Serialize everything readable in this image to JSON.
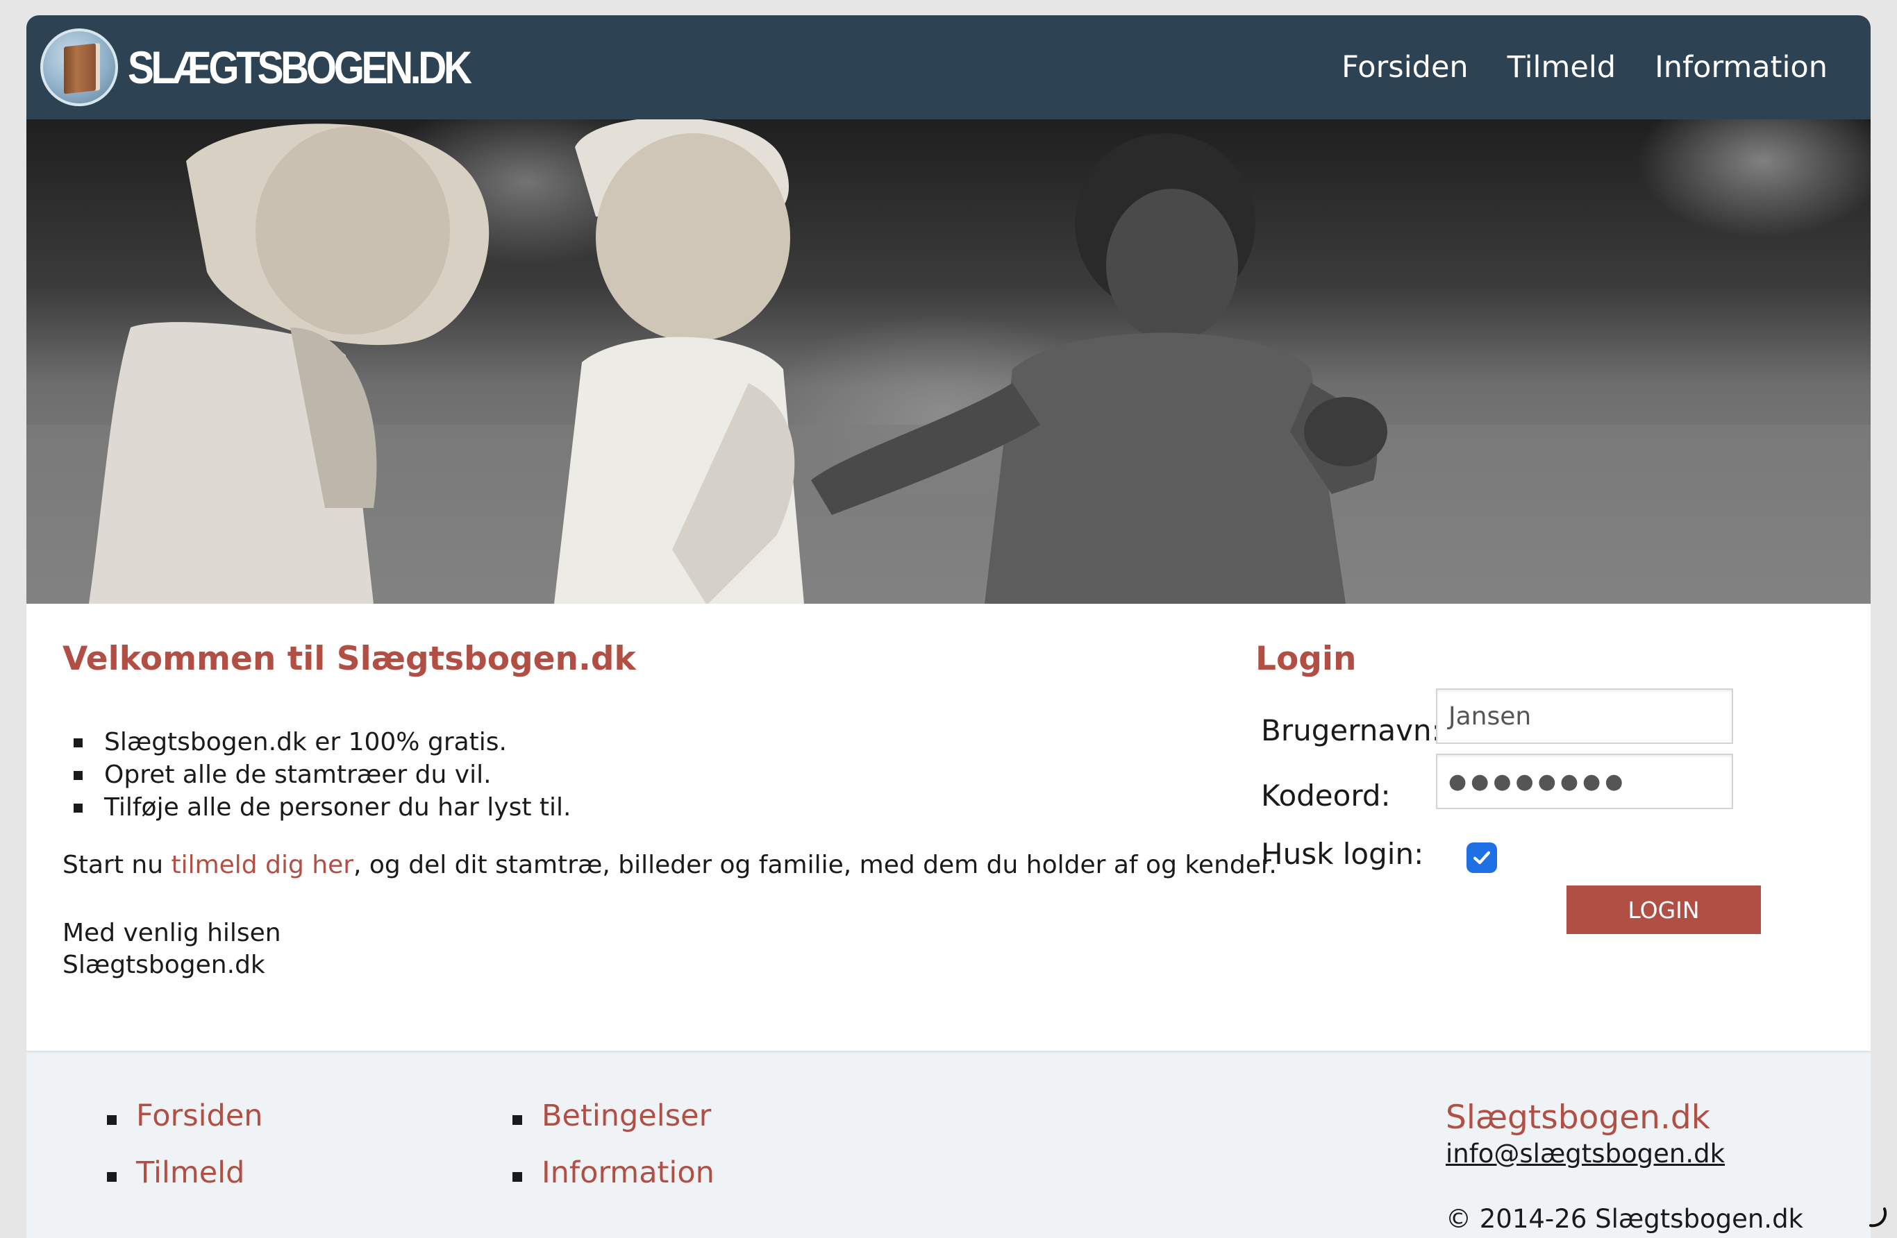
{
  "brand": {
    "logo_text": "SLÆGTSBOGEN.DK"
  },
  "nav": {
    "items": [
      {
        "label": "Forsiden"
      },
      {
        "label": "Tilmeld"
      },
      {
        "label": "Information"
      }
    ]
  },
  "welcome": {
    "title": "Velkommen til Slægtsbogen.dk",
    "features": [
      "Slægtsbogen.dk er 100% gratis.",
      "Opret alle de stamtræer du vil.",
      "Tilføje alle de personer du har lyst til."
    ],
    "intro_before": "Start nu ",
    "intro_link": "tilmeld dig her",
    "intro_after": ", og del dit stamtræ, billeder og familie, med dem du holder af og kender.",
    "signoff_line1": "Med venlig hilsen",
    "signoff_line2": "Slægtsbogen.dk"
  },
  "login": {
    "title": "Login",
    "username_label": "Brugernavn:",
    "username_value": "Jansen",
    "password_label": "Kodeord:",
    "password_value": "●●●●●●●●",
    "remember_label": "Husk login:",
    "remember_checked": true,
    "button_label": "LOGIN"
  },
  "footer": {
    "links_col1": [
      "Forsiden",
      "Tilmeld"
    ],
    "links_col2": [
      "Betingelser",
      "Information"
    ],
    "brand": "Slægtsbogen.dk",
    "email": "info@slægtsbogen.dk",
    "copyright": "© 2014-26 Slægtsbogen.dk"
  },
  "colors": {
    "header_bg": "#2d4252",
    "accent": "#b14f44",
    "footer_bg": "#f0f3f6",
    "checkbox": "#1f6fe5"
  },
  "icons": [
    "book-globe-logo-icon",
    "checkmark-icon",
    "loading-spinner-icon"
  ]
}
